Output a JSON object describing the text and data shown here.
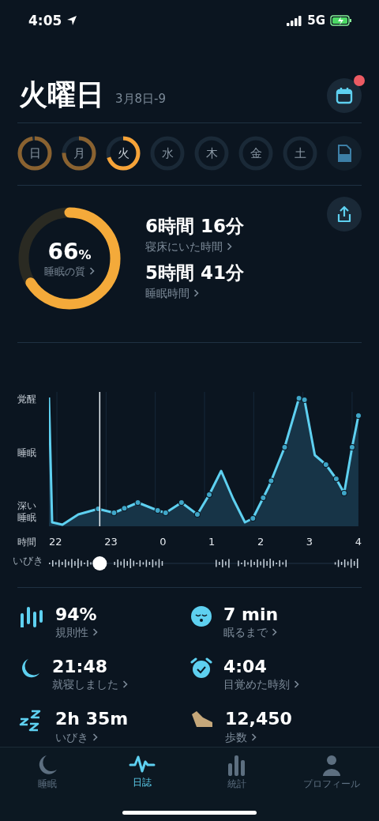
{
  "status_bar": {
    "time": "4:05",
    "network": "5G"
  },
  "header": {
    "title": "火曜日",
    "date": "3月8日-9",
    "calendar_badge": true
  },
  "days": [
    {
      "label": "日",
      "level": 0.97,
      "selected": false
    },
    {
      "label": "月",
      "level": 0.75,
      "selected": false
    },
    {
      "label": "火",
      "level": 0.7,
      "selected": true
    },
    {
      "label": "水",
      "level": 0,
      "selected": false
    },
    {
      "label": "木",
      "level": 0,
      "selected": false
    },
    {
      "label": "金",
      "level": 0,
      "selected": false
    },
    {
      "label": "土",
      "level": 0,
      "selected": false
    }
  ],
  "summary": {
    "quality": {
      "value": "66",
      "unit": "%",
      "label": "睡眠の質",
      "level": 0.66
    },
    "metrics": [
      {
        "value": "6時間 16分",
        "label": "寝床にいた時間"
      },
      {
        "value": "5時間 41分",
        "label": "睡眠時間"
      }
    ]
  },
  "sleep_graph": {
    "y_labels": [
      "覚醒",
      "睡眠",
      "深い睡眠"
    ],
    "x_title": "時間",
    "x_labels": [
      "22",
      "23",
      "0",
      "1",
      "2",
      "3",
      "4"
    ],
    "snore_label": "いびき"
  },
  "stats": [
    {
      "kind": "regularity",
      "value": "94%",
      "label": "規則性"
    },
    {
      "kind": "fall_asleep",
      "value": "7 min",
      "label": "眠るまで"
    },
    {
      "kind": "bedtime",
      "value": "21:48",
      "label": "就寝しました"
    },
    {
      "kind": "wake",
      "value": "4:04",
      "label": "目覚めた時刻"
    },
    {
      "kind": "snore",
      "value": "2h 35m",
      "label": "いびき"
    },
    {
      "kind": "steps",
      "value": "12,450",
      "label": "歩数"
    }
  ],
  "tab_bar": [
    {
      "kind": "sleep",
      "label": "睡眠",
      "selected": false
    },
    {
      "kind": "journal",
      "label": "日誌",
      "selected": true
    },
    {
      "kind": "stats",
      "label": "統計",
      "selected": false
    },
    {
      "kind": "profile",
      "label": "プロフィール",
      "selected": false
    }
  ]
}
